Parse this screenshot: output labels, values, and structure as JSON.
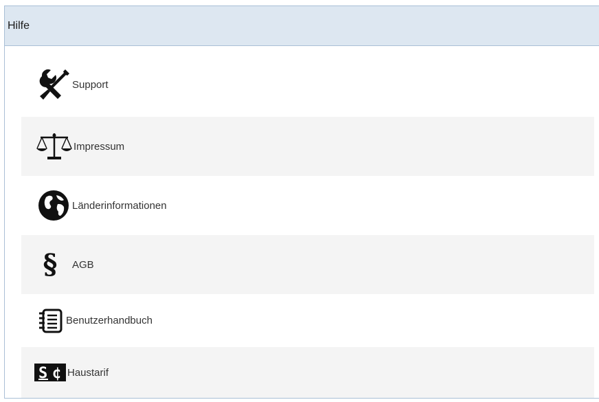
{
  "panel": {
    "title": "Hilfe"
  },
  "items": [
    {
      "label": "Support",
      "icon": "tools-icon"
    },
    {
      "label": "Impressum",
      "icon": "scales-icon"
    },
    {
      "label": "Länderinformationen",
      "icon": "globe-icon"
    },
    {
      "label": "AGB",
      "icon": "paragraph-icon"
    },
    {
      "label": "Benutzerhandbuch",
      "icon": "notebook-icon"
    },
    {
      "label": "Haustarif",
      "icon": "price-tag-icon"
    }
  ],
  "colors": {
    "header_bg": "#dde7f1",
    "border": "#a9bfd6",
    "alt_row_bg": "#f4f4f4",
    "text": "#333333"
  }
}
